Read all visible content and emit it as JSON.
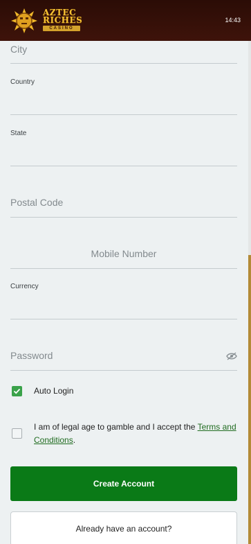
{
  "header": {
    "logo_line1": "AZTEC",
    "logo_line2": "RICHES",
    "logo_line3": "CASINO",
    "time": "14:43"
  },
  "form": {
    "city_placeholder": "City",
    "country_label": "Country",
    "state_label": "State",
    "postal_placeholder": "Postal Code",
    "mobile_placeholder": "Mobile Number",
    "currency_label": "Currency",
    "password_placeholder": "Password"
  },
  "options": {
    "auto_login_label": "Auto Login",
    "auto_login_checked": true,
    "legal_text": "I am of legal age to gamble and I accept the ",
    "terms_link": "Terms and Conditions",
    "legal_suffix": ".",
    "legal_checked": false
  },
  "buttons": {
    "create_account": "Create Account",
    "already_account": "Already have an account?"
  },
  "colors": {
    "header_bg": "#3e130a",
    "primary_button": "#0a7a17",
    "checkbox_checked": "#3aa24a",
    "logo_gold": "#f6c232",
    "scroll_thumb": "#b38a37"
  }
}
